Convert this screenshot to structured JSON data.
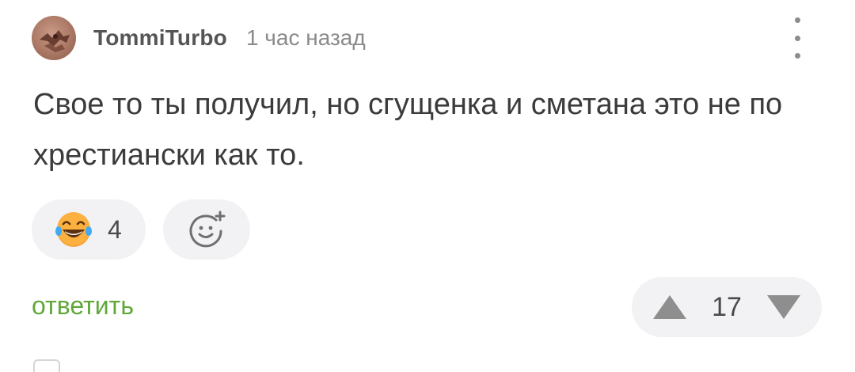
{
  "comment": {
    "author": "TommiTurbo",
    "timestamp": "1 час назад",
    "text": "Свое то ты получил, но сгущенка и сметана это не по хрестиански как то.",
    "reactions": [
      {
        "emoji": "laughing-emoji-icon",
        "count": "4"
      }
    ],
    "reply_label": "ответить",
    "rating": "17"
  },
  "colors": {
    "reply_green": "#5fa838",
    "pill_background": "#f2f2f4",
    "vote_arrow": "#8e8e8e"
  }
}
